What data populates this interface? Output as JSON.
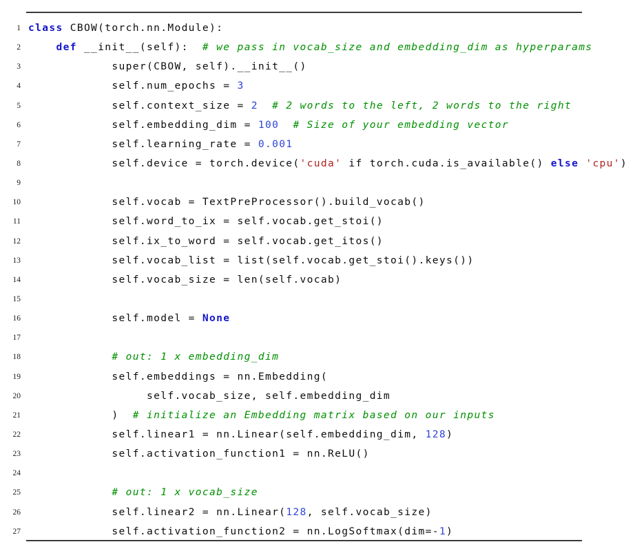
{
  "document": {
    "kind": "code-listing",
    "language": "Python",
    "rules": {
      "top": true,
      "bottom": true
    },
    "colors": {
      "keyword": "#1616c8",
      "number": "#2f44d6",
      "string": "#b02020",
      "comment": "#009000",
      "plain": "#0d0d0d",
      "rule": "#3a3a3a",
      "line_number": "#1c1c1c",
      "background": "#ffffff"
    }
  },
  "lines": [
    {
      "number": "1",
      "plain": "class CBOW(torch.nn.Module):",
      "tokens": [
        {
          "t": "class",
          "k": "kw"
        },
        {
          "t": " CBOW(torch.nn.Module):",
          "k": "pln"
        }
      ]
    },
    {
      "number": "2",
      "plain": "    def __init__(self):  # we pass in vocab_size and embedding_dim as hyperparams",
      "tokens": [
        {
          "t": "    ",
          "k": "pln"
        },
        {
          "t": "def",
          "k": "kw"
        },
        {
          "t": " __init__(self):  ",
          "k": "pln"
        },
        {
          "t": "# we pass in vocab_size and embedding_dim as hyperparams",
          "k": "cmt"
        }
      ]
    },
    {
      "number": "3",
      "plain": "            super(CBOW, self).__init__()",
      "tokens": [
        {
          "t": "            super(CBOW, self).__init__()",
          "k": "pln"
        }
      ]
    },
    {
      "number": "4",
      "plain": "            self.num_epochs = 3",
      "tokens": [
        {
          "t": "            self.num_epochs = ",
          "k": "pln"
        },
        {
          "t": "3",
          "k": "num"
        }
      ]
    },
    {
      "number": "5",
      "plain": "            self.context_size = 2  # 2 words to the left, 2 words to the right",
      "tokens": [
        {
          "t": "            self.context_size = ",
          "k": "pln"
        },
        {
          "t": "2",
          "k": "num"
        },
        {
          "t": "  ",
          "k": "pln"
        },
        {
          "t": "# 2 words to the left, 2 words to the right",
          "k": "cmt"
        }
      ]
    },
    {
      "number": "6",
      "plain": "            self.embedding_dim = 100  # Size of your embedding vector",
      "tokens": [
        {
          "t": "            self.embedding_dim = ",
          "k": "pln"
        },
        {
          "t": "100",
          "k": "num"
        },
        {
          "t": "  ",
          "k": "pln"
        },
        {
          "t": "# Size of your embedding vector",
          "k": "cmt"
        }
      ]
    },
    {
      "number": "7",
      "plain": "            self.learning_rate = 0.001",
      "tokens": [
        {
          "t": "            self.learning_rate = ",
          "k": "pln"
        },
        {
          "t": "0.001",
          "k": "num"
        }
      ]
    },
    {
      "number": "8",
      "plain": "            self.device = torch.device('cuda' if torch.cuda.is_available() else 'cpu')",
      "tokens": [
        {
          "t": "            self.device = torch.device(",
          "k": "pln"
        },
        {
          "t": "'cuda'",
          "k": "str"
        },
        {
          "t": " if torch.cuda.is_available() ",
          "k": "pln"
        },
        {
          "t": "else",
          "k": "kw"
        },
        {
          "t": " ",
          "k": "pln"
        },
        {
          "t": "'cpu'",
          "k": "str"
        },
        {
          "t": ")",
          "k": "pln"
        }
      ]
    },
    {
      "number": "9",
      "plain": "",
      "tokens": []
    },
    {
      "number": "10",
      "plain": "            self.vocab = TextPreProcessor().build_vocab()",
      "tokens": [
        {
          "t": "            self.vocab = TextPreProcessor().build_vocab()",
          "k": "pln"
        }
      ]
    },
    {
      "number": "11",
      "plain": "            self.word_to_ix = self.vocab.get_stoi()",
      "tokens": [
        {
          "t": "            self.word_to_ix = self.vocab.get_stoi()",
          "k": "pln"
        }
      ]
    },
    {
      "number": "12",
      "plain": "            self.ix_to_word = self.vocab.get_itos()",
      "tokens": [
        {
          "t": "            self.ix_to_word = self.vocab.get_itos()",
          "k": "pln"
        }
      ]
    },
    {
      "number": "13",
      "plain": "            self.vocab_list = list(self.vocab.get_stoi().keys())",
      "tokens": [
        {
          "t": "            self.vocab_list = list(self.vocab.get_stoi().keys())",
          "k": "pln"
        }
      ]
    },
    {
      "number": "14",
      "plain": "            self.vocab_size = len(self.vocab)",
      "tokens": [
        {
          "t": "            self.vocab_size = len(self.vocab)",
          "k": "pln"
        }
      ]
    },
    {
      "number": "15",
      "plain": "",
      "tokens": []
    },
    {
      "number": "16",
      "plain": "            self.model = None",
      "tokens": [
        {
          "t": "            self.model = ",
          "k": "pln"
        },
        {
          "t": "None",
          "k": "kw"
        }
      ]
    },
    {
      "number": "17",
      "plain": "",
      "tokens": []
    },
    {
      "number": "18",
      "plain": "            # out: 1 x embedding_dim",
      "tokens": [
        {
          "t": "            ",
          "k": "pln"
        },
        {
          "t": "# out: 1 x embedding_dim",
          "k": "cmt"
        }
      ]
    },
    {
      "number": "19",
      "plain": "            self.embeddings = nn.Embedding(",
      "tokens": [
        {
          "t": "            self.embeddings = nn.Embedding(",
          "k": "pln"
        }
      ]
    },
    {
      "number": "20",
      "plain": "                 self.vocab_size, self.embedding_dim",
      "tokens": [
        {
          "t": "                 self.vocab_size, self.embedding_dim",
          "k": "pln"
        }
      ]
    },
    {
      "number": "21",
      "plain": "            )  # initialize an Embedding matrix based on our inputs",
      "tokens": [
        {
          "t": "            )  ",
          "k": "pln"
        },
        {
          "t": "# initialize an Embedding matrix based on our inputs",
          "k": "cmt"
        }
      ]
    },
    {
      "number": "22",
      "plain": "            self.linear1 = nn.Linear(self.embedding_dim, 128)",
      "tokens": [
        {
          "t": "            self.linear1 = nn.Linear(self.embedding_dim, ",
          "k": "pln"
        },
        {
          "t": "128",
          "k": "num"
        },
        {
          "t": ")",
          "k": "pln"
        }
      ]
    },
    {
      "number": "23",
      "plain": "            self.activation_function1 = nn.ReLU()",
      "tokens": [
        {
          "t": "            self.activation_function1 = nn.ReLU()",
          "k": "pln"
        }
      ]
    },
    {
      "number": "24",
      "plain": "",
      "tokens": []
    },
    {
      "number": "25",
      "plain": "            # out: 1 x vocab_size",
      "tokens": [
        {
          "t": "            ",
          "k": "pln"
        },
        {
          "t": "# out: 1 x vocab_size",
          "k": "cmt"
        }
      ]
    },
    {
      "number": "26",
      "plain": "            self.linear2 = nn.Linear(128, self.vocab_size)",
      "tokens": [
        {
          "t": "            self.linear2 = nn.Linear(",
          "k": "pln"
        },
        {
          "t": "128",
          "k": "num"
        },
        {
          "t": ", self.vocab_size)",
          "k": "pln"
        }
      ]
    },
    {
      "number": "27",
      "plain": "            self.activation_function2 = nn.LogSoftmax(dim=-1)",
      "tokens": [
        {
          "t": "            self.activation_function2 = nn.LogSoftmax(dim=-",
          "k": "pln"
        },
        {
          "t": "1",
          "k": "num"
        },
        {
          "t": ")",
          "k": "pln"
        }
      ]
    }
  ]
}
